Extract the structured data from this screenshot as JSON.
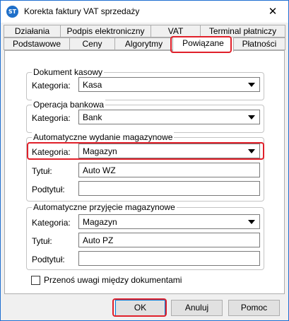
{
  "window": {
    "title": "Korekta faktury VAT sprzedaży",
    "app_icon_text": "ST",
    "close_glyph": "✕"
  },
  "tabs": {
    "row1": [
      "Działania",
      "Podpis elektroniczny",
      "VAT",
      "Terminal płatniczy"
    ],
    "row2": [
      "Podstawowe",
      "Ceny",
      "Algorytmy",
      "Powiązane",
      "Płatności"
    ],
    "active": "Powiązane"
  },
  "groups": {
    "cash": {
      "legend": "Dokument kasowy",
      "category_label": "Kategoria:",
      "category_value": "Kasa"
    },
    "bank": {
      "legend": "Operacja bankowa",
      "category_label": "Kategoria:",
      "category_value": "Bank"
    },
    "issue": {
      "legend": "Automatyczne wydanie magazynowe",
      "category_label": "Kategoria:",
      "category_value": "Magazyn",
      "title_label": "Tytuł:",
      "title_value": "Auto WZ",
      "subtitle_label": "Podtytuł:",
      "subtitle_value": ""
    },
    "receipt": {
      "legend": "Automatyczne przyjęcie magazynowe",
      "category_label": "Kategoria:",
      "category_value": "Magazyn",
      "title_label": "Tytuł:",
      "title_value": "Auto PZ",
      "subtitle_label": "Podtytuł:",
      "subtitle_value": ""
    }
  },
  "checkbox": {
    "label": "Przenoś uwagi między dokumentami",
    "checked": false
  },
  "buttons": {
    "ok": "OK",
    "cancel": "Anuluj",
    "help": "Pomoc"
  },
  "colors": {
    "highlight": "#e0202a",
    "accent": "#0078d7"
  }
}
